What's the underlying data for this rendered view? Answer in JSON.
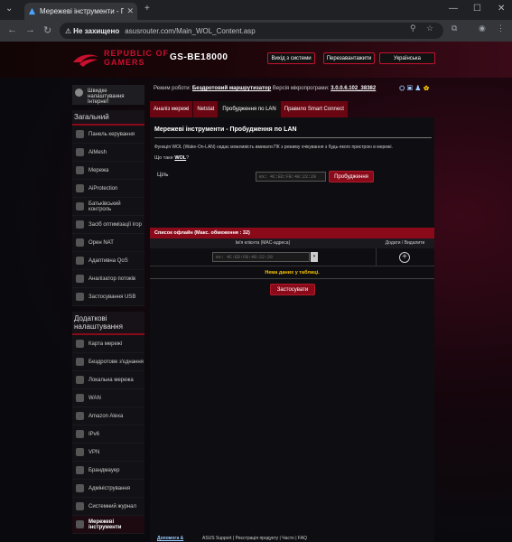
{
  "browser": {
    "tab_title": "Мережеві інструменти - Пробу...",
    "address_warning": "Не захищено",
    "url": "asusrouter.com/Main_WOL_Content.asp"
  },
  "header": {
    "brand_line1": "REPUBLIC OF",
    "brand_line2": "GAMERS",
    "model": "GS-BE18000",
    "logout": "Вихід з системи",
    "reboot": "Перезавантажити",
    "language": "Українська"
  },
  "status": {
    "mode_label": "Режим роботи:",
    "mode_value": "Бездротовий маршрутизатор",
    "firmware_label": "Версія мікропрограми:",
    "firmware_value": "3.0.0.6.102_38382"
  },
  "sidebar": {
    "quick_setup": "Швидке налаштування Інтернет",
    "general_title": "Загальний",
    "general_items": [
      {
        "label": "Панель керування",
        "icon": "dashboard-icon"
      },
      {
        "label": "AiMesh",
        "icon": "aimesh-icon"
      },
      {
        "label": "Мережа",
        "icon": "network-icon"
      },
      {
        "label": "AiProtection",
        "icon": "shield-icon"
      },
      {
        "label": "Батьківський контроль",
        "icon": "parental-icon"
      },
      {
        "label": "Засіб оптимізації ігор",
        "icon": "game-icon"
      },
      {
        "label": "Opeн NAT",
        "icon": "nat-icon"
      },
      {
        "label": "Адаптивна QoS",
        "icon": "qos-icon"
      },
      {
        "label": "Аналізатор потоків",
        "icon": "traffic-icon"
      },
      {
        "label": "Застосування USB",
        "icon": "usb-icon"
      }
    ],
    "advanced_title": "Додаткові налаштування",
    "advanced_items": [
      {
        "label": "Карта мережі",
        "icon": "map-icon"
      },
      {
        "label": "Бездротове з'єднання",
        "icon": "wireless-icon"
      },
      {
        "label": "Локальна мережа",
        "icon": "lan-icon"
      },
      {
        "label": "WAN",
        "icon": "wan-icon"
      },
      {
        "label": "Amazon Alexa",
        "icon": "alexa-icon"
      },
      {
        "label": "IPv6",
        "icon": "ipv6-icon"
      },
      {
        "label": "VPN",
        "icon": "vpn-icon"
      },
      {
        "label": "Брандмауер",
        "icon": "firewall-icon"
      },
      {
        "label": "Адміністрування",
        "icon": "admin-icon"
      },
      {
        "label": "Системний журнал",
        "icon": "log-icon"
      },
      {
        "label": "Мережеві інструменти",
        "icon": "tools-icon"
      }
    ]
  },
  "tabs": [
    "Аналіз мережі",
    "Netstat",
    "Пробудження по LAN",
    "Правило Smart Connect"
  ],
  "content": {
    "title": "Мережеві інструменти - Пробудження по LAN",
    "description": "Функція WOL (Wake-On-LAN) надає можливість вмикати ПК з режиму очікування з будь-якого пристрою в мережі.",
    "what_is": "Що таке",
    "wol_link": "WOL",
    "what_is_suffix": "?",
    "target_label": "Ціль",
    "mac_placeholder": "ex: 4C:ED:FB:48:22:20",
    "wake_button": "Пробудження",
    "offline_list_title": "Список офлайн (Макс. обмеження : 32)",
    "col_client": "Ім'я клієнта (MAC-адреса)",
    "col_action": "Додати / Видалити",
    "no_data": "Нема даних у таблиці.",
    "apply_button": "Застосувати"
  },
  "footer": {
    "help": "Допомога &",
    "text": "ASUS Support | Реєстрація продукту | Часто | FAQ"
  }
}
